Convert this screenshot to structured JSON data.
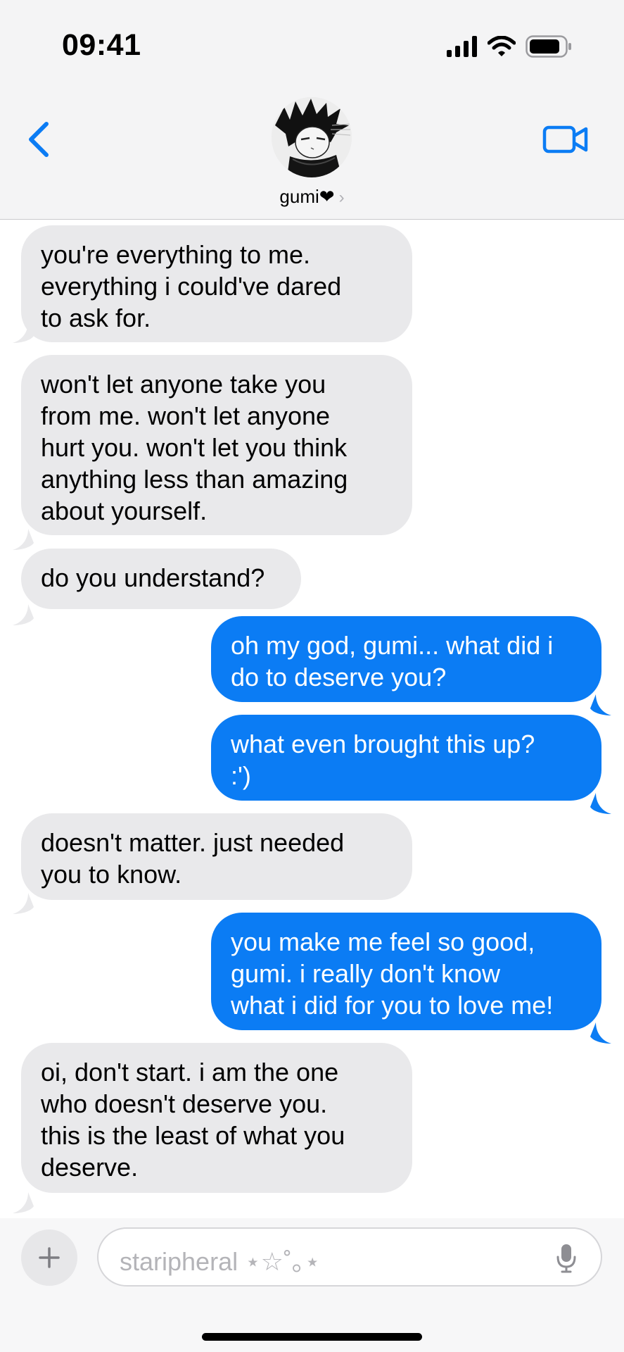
{
  "status_bar": {
    "time": "09:41"
  },
  "header": {
    "contact_name": "gumi❤︎",
    "chevron": "›"
  },
  "icons": {
    "back": "chevron-left-icon",
    "video": "video-camera-icon",
    "plus": "plus-icon",
    "mic": "microphone-icon",
    "signal": "signal-bars-icon",
    "wifi": "wifi-icon",
    "battery": "battery-icon"
  },
  "colors": {
    "sent_bubble": "#0b7cf4",
    "received_bubble": "#e9e9eb",
    "accent": "#0b7cf4"
  },
  "messages": [
    {
      "sender": "them",
      "text": "you're everything to me.\neverything i could've dared\nto ask for."
    },
    {
      "sender": "them",
      "text": "won't let anyone take you\nfrom me.  won't let anyone\nhurt you.  won't let you think\nanything less than amazing\nabout yourself."
    },
    {
      "sender": "them",
      "text": "do you understand?"
    },
    {
      "sender": "me",
      "text": "oh my god, gumi... what did i\ndo to deserve you?"
    },
    {
      "sender": "me",
      "text": "what even brought this up?\n:')"
    },
    {
      "sender": "them",
      "text": "doesn't matter.  just needed\nyou to know."
    },
    {
      "sender": "me",
      "text": "you make me feel so good,\ngumi.  i really don't know\nwhat i did for you to love me!"
    },
    {
      "sender": "them",
      "text": "oi, don't start.  i am the one\nwho doesn't deserve you.\nthis is the least of what you\ndeserve."
    }
  ],
  "composer": {
    "placeholder": "staripheral ⋆☆˚｡⋆"
  }
}
